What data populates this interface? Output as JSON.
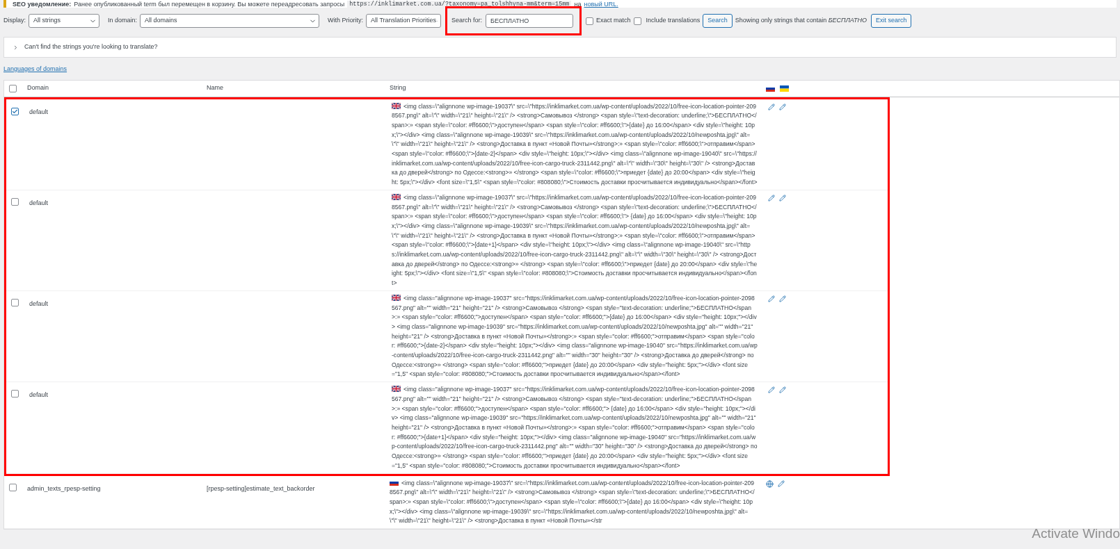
{
  "notice": {
    "label": "SEO уведомление:",
    "text": "Ранее опубликованный term был перемещен в корзину. Вы можете переадресовать запросы",
    "code": "https://inklimarket.com.ua/?taxonomy=pa_tolshhyna-mm&term=15mm",
    "text_after": "на",
    "link": "новый URL."
  },
  "filters": {
    "display": {
      "label": "Display:",
      "value": "All strings"
    },
    "domain": {
      "label": "In domain:",
      "value": "All domains"
    },
    "priority": {
      "label": "With Priority:",
      "value": "All Translation Priorities"
    },
    "search": {
      "label": "Search for:",
      "value": "БЕСПЛАТНО"
    },
    "exact_match": {
      "label": "Exact match",
      "checked": false
    },
    "include_translations": {
      "label": "Include translations",
      "checked": false
    },
    "search_button": "Search",
    "status": "Showing only strings that contain *БЕСПЛАТНО*",
    "exit_button": "Exit search"
  },
  "help_panel": {
    "label": "Can't find the strings you're looking to translate?",
    "expanded": false
  },
  "languages_link": "Languages of domains",
  "table": {
    "select_all": {
      "checked": false
    },
    "columns": [
      "Domain",
      "Name",
      "String"
    ],
    "language_flags": [
      {
        "kind": "ru"
      },
      {
        "kind": "ua"
      }
    ],
    "rows": [
      {
        "checked": true,
        "highlighted": true,
        "domain": "default",
        "flag": {
          "kind": "gb"
        },
        "string": "<img class=\\\"alignnone wp-image-19037\\\" src=\\\"https://inklimarket.com.ua/wp-content/uploads/2022/10/free-icon-location-pointer-2098567.png\\\" alt=\\\"\\\" width=\\\"21\\\" height=\\\"21\\\" /> <strong>Самовывоз </strong> <span style=\\\"text-decoration: underline;\\\">БЕСПЛАТНО</span>:» <span style=\\\"color: #ff6600;\\\">доступен</span> <span style=\\\"color: #ff6600;\\\">{date} до 16:00</span> <div style=\\\"height: 10px;\\\"></div> <img class=\\\"alignnone wp-image-19039\\\" src=\\\"https://inklimarket.com.ua/wp-content/uploads/2022/10/newposhta.jpg\\\" alt=\\\"\\\" width=\\\"21\\\" height=\\\"21\\\" /> <strong>Доставка в пункт «Новой Почты»</strong>:» <span style=\\\"color: #ff6600;\\\">отправим</span> <span style=\\\"color: #ff6600;\\\">{date-2}</span> <div style=\\\"height: 10px;\\\"></div> <img class=\\\"alignnone wp-image-19040\\\" src=\\\"https://inklimarket.com.ua/wp-content/uploads/2022/10/free-icon-cargo-truck-2311442.png\\\" alt=\\\"\\\" width=\\\"30\\\" height=\\\"30\\\" /> <strong>Доставка до дверей</strong> по Одессе:<strong>» </strong> <span style=\\\"color: #ff6600;\\\">приедет {date} до 20:00</span> <div style=\\\"height: 5px;\\\"></div> <font size=\\\"1,5\\\" <span style=\\\"color: #808080;\\\">Стоимость доставки просчитывается индивидуально</span></font>",
        "actions": [
          {
            "kind": "pencil"
          },
          {
            "kind": "pencil"
          }
        ]
      },
      {
        "checked": false,
        "highlighted": true,
        "domain": "default",
        "flag": {
          "kind": "gb"
        },
        "string": "<img class=\\\"alignnone wp-image-19037\\\" src=\\\"https://inklimarket.com.ua/wp-content/uploads/2022/10/free-icon-location-pointer-2098567.png\\\" alt=\\\"\\\" width=\\\"21\\\" height=\\\"21\\\" /> <strong>Самовывоз </strong> <span style=\\\"text-decoration: underline;\\\">БЕСПЛАТНО</span>:» <span style=\\\"color: #ff6600;\\\">доступен</span> <span style=\\\"color: #ff6600;\\\"> {date} до 16:00</span> <div style=\\\"height: 10px;\\\"></div> <img class=\\\"alignnone wp-image-19039\\\" src=\\\"https://inklimarket.com.ua/wp-content/uploads/2022/10/newposhta.jpg\\\" alt=\\\"\\\" width=\\\"21\\\" height=\\\"21\\\" /> <strong>Доставка в пункт «Новой Почты»</strong>:» <span style=\\\"color: #ff6600;\\\">отправим</span> <span style=\\\"color: #ff6600;\\\">{date+1}</span> <div style=\\\"height: 10px;\\\"></div> <img class=\\\"alignnone wp-image-19040\\\" src=\\\"https://inklimarket.com.ua/wp-content/uploads/2022/10/free-icon-cargo-truck-2311442.png\\\" alt=\\\"\\\" width=\\\"30\\\" height=\\\"30\\\" /> <strong>Доставка до дверей</strong> по Одессе:<strong>» </strong> <span style=\\\"color: #ff6600;\\\">приедет {date} до 20:00</span> <div style=\\\"height: 5px;\\\"></div> <font size=\\\"1,5\\\" <span style=\\\"color: #808080;\\\">Стоимость доставки просчитывается индивидуально</span></font>",
        "actions": [
          {
            "kind": "pencil"
          },
          {
            "kind": "pencil"
          }
        ]
      },
      {
        "checked": false,
        "highlighted": true,
        "domain": "default",
        "flag": {
          "kind": "gb"
        },
        "string": "<img class=\"alignnone wp-image-19037\" src=\"https://inklimarket.com.ua/wp-content/uploads/2022/10/free-icon-location-pointer-2098567.png\" alt=\"\" width=\"21\" height=\"21\" /> <strong>Самовывоз </strong> <span style=\"text-decoration: underline;\">БЕСПЛАТНО</span>:» <span style=\"color: #ff6600;\">доступен</span> <span style=\"color: #ff6600;\">{date} до 16:00</span> <div style=\"height: 10px;\"></div> <img class=\"alignnone wp-image-19039\" src=\"https://inklimarket.com.ua/wp-content/uploads/2022/10/newposhta.jpg\" alt=\"\" width=\"21\" height=\"21\" /> <strong>Доставка в пункт «Новой Почты»</strong>:» <span style=\"color: #ff6600;\">отправим</span> <span style=\"color: #ff6600;\">{date-2}</span> <div style=\"height: 10px;\"></div> <img class=\"alignnone wp-image-19040\" src=\"https://inklimarket.com.ua/wp-content/uploads/2022/10/free-icon-cargo-truck-2311442.png\" alt=\"\" width=\"30\" height=\"30\" /> <strong>Доставка до дверей</strong> по Одессе:<strong>» </strong> <span style=\"color: #ff6600;\">приедет {date} до 20:00</span> <div style=\"height: 5px;\"></div> <font size=\"1,5\" <span style=\"color: #808080;\">Стоимость доставки просчитывается индивидуально</span></font>",
        "actions": [
          {
            "kind": "pencil"
          },
          {
            "kind": "pencil"
          }
        ]
      },
      {
        "checked": false,
        "highlighted": true,
        "domain": "default",
        "flag": {
          "kind": "gb"
        },
        "string": "<img class=\"alignnone wp-image-19037\" src=\"https://inklimarket.com.ua/wp-content/uploads/2022/10/free-icon-location-pointer-2098567.png\" alt=\"\" width=\"21\" height=\"21\" /> <strong>Самовывоз </strong> <span style=\"text-decoration: underline;\">БЕСПЛАТНО</span>:» <span style=\"color: #ff6600;\">доступен</span> <span style=\"color: #ff6600;\"> {date} до 16:00</span> <div style=\"height: 10px;\"></div> <img class=\"alignnone wp-image-19039\" src=\"https://inklimarket.com.ua/wp-content/uploads/2022/10/newposhta.jpg\" alt=\"\" width=\"21\" height=\"21\" /> <strong>Доставка в пункт «Новой Почты»</strong>:» <span style=\"color: #ff6600;\">отправим</span> <span style=\"color: #ff6600;\">{date+1}</span> <div style=\"height: 10px;\"></div> <img class=\"alignnone wp-image-19040\" src=\"https://inklimarket.com.ua/wp-content/uploads/2022/10/free-icon-cargo-truck-2311442.png\" alt=\"\" width=\"30\" height=\"30\" /> <strong>Доставка до дверей</strong> по Одессе:<strong>» </strong> <span style=\"color: #ff6600;\">приедет {date} до 20:00</span> <div style=\"height: 5px;\"></div> <font size=\"1,5\" <span style=\"color: #808080;\">Стоимость доставки просчитывается индивидуально</span></font>",
        "actions": [
          {
            "kind": "pencil"
          },
          {
            "kind": "pencil"
          }
        ]
      },
      {
        "checked": false,
        "domain": "admin_texts_rpesp-setting",
        "name": "[rpesp-setting]estimate_text_backorder",
        "highlighted": false,
        "flag": {
          "kind": "ru"
        },
        "string": "<img class=\\\"alignnone wp-image-19037\\\" src=\\\"https://inklimarket.com.ua/wp-content/uploads/2022/10/free-icon-location-pointer-2098567.png\\\" alt=\\\"\\\" width=\\\"21\\\" height=\\\"21\\\" /> <strong>Самовывоз </strong> <span style=\\\"text-decoration: underline;\\\">БЕСПЛАТНО</span>:» <span style=\\\"color: #ff6600;\\\">доступен</span> <span style=\\\"color: #ff6600;\\\">{date} до 16:00</span> <div style=\\\"height: 10px;\\\"></div> <img class=\\\"alignnone wp-image-19039\\\" src=\\\"https://inklimarket.com.ua/wp-content/uploads/2022/10/newposhta.jpg\\\" alt=\\\"\\\" width=\\\"21\\\" height=\\\"21\\\" /> <strong>Доставка в пункт «Новой Почты»</str",
        "actions": [
          {
            "kind": "globe"
          },
          {
            "kind": "pencil"
          }
        ]
      }
    ]
  },
  "os_notice": "Activate Windo"
}
